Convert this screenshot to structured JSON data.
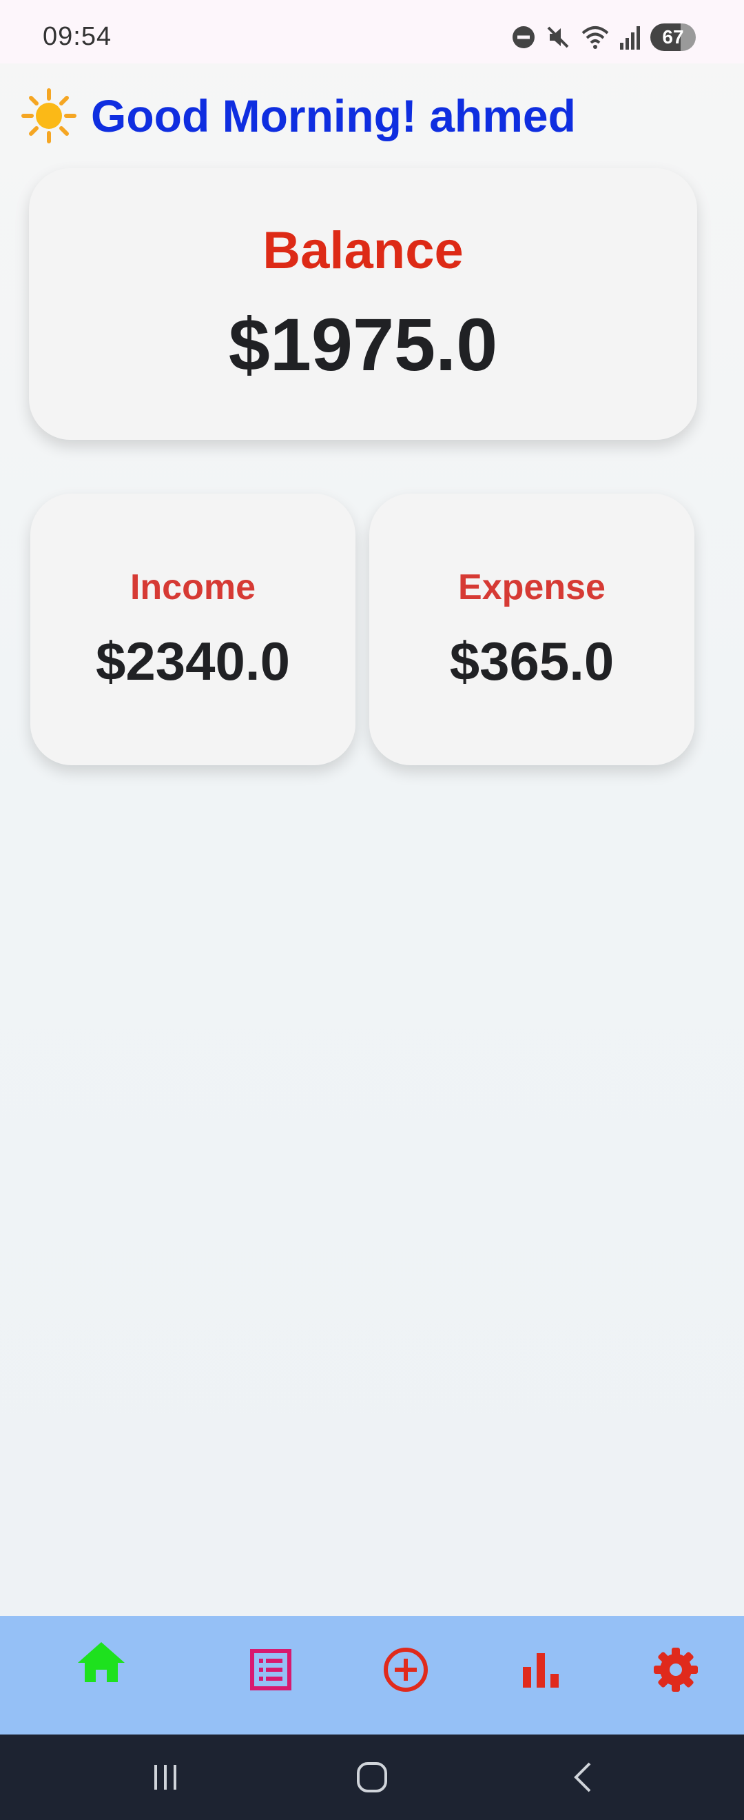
{
  "status_bar": {
    "time": "09:54",
    "battery": "67"
  },
  "greeting": {
    "emoji": "☀️",
    "text": "Good Morning! ahmed"
  },
  "balance": {
    "label": "Balance",
    "value": "$1975.0"
  },
  "income": {
    "label": "Income",
    "value": "$2340.0"
  },
  "expense": {
    "label": "Expense",
    "value": "$365.0"
  },
  "bottom_nav": {
    "items": [
      {
        "icon": "home-icon",
        "color": "#1ee11e",
        "active": true
      },
      {
        "icon": "list-icon",
        "color": "#d8196f"
      },
      {
        "icon": "add-circle-icon",
        "color": "#e02a1c"
      },
      {
        "icon": "bar-chart-icon",
        "color": "#e02a1c"
      },
      {
        "icon": "gear-icon",
        "color": "#e02a1c"
      }
    ]
  },
  "colors": {
    "greeting": "#0f2ee0",
    "balance_label": "#dd2a16",
    "card_label": "#d63a34",
    "nav_background": "#95c0f6"
  }
}
